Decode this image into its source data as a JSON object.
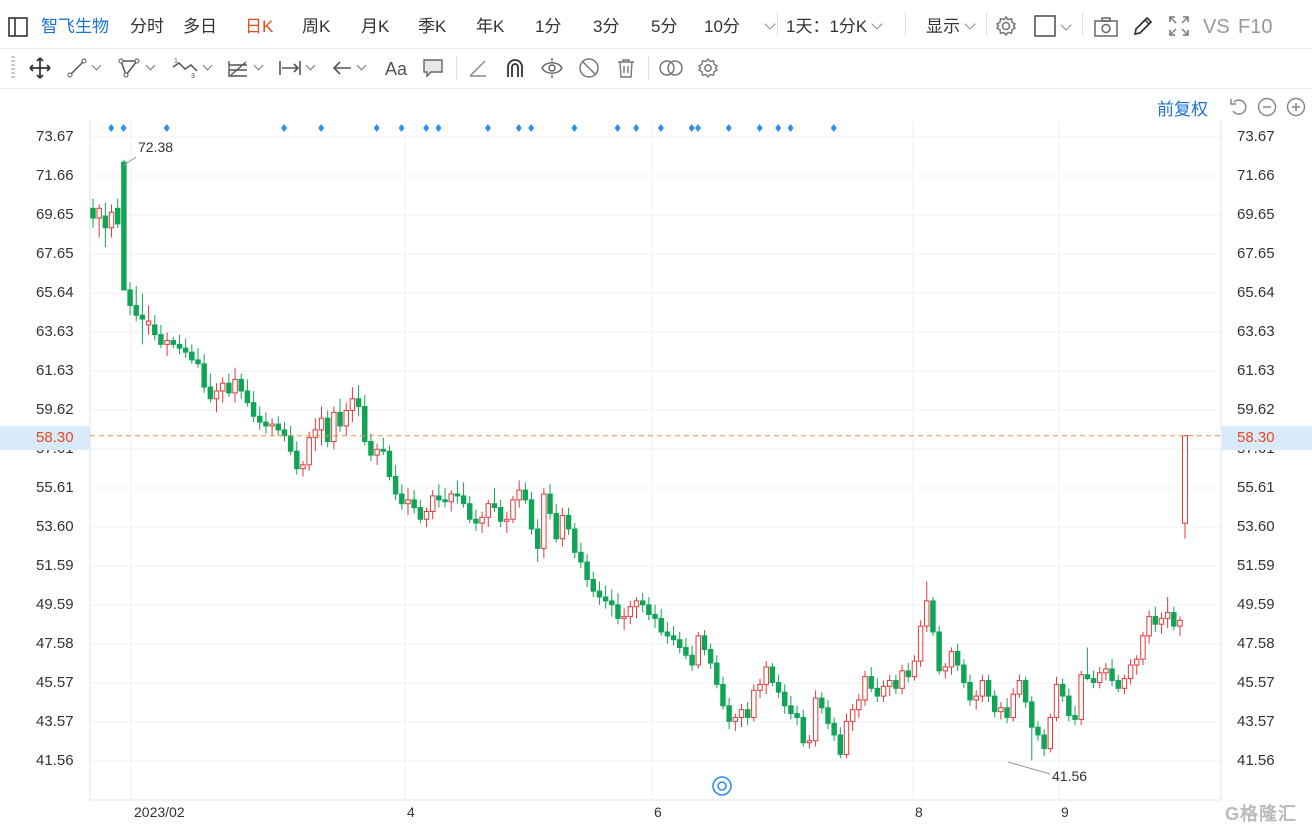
{
  "toolbar": {
    "stock_name": "智飞生物",
    "periods": [
      {
        "label": "分时",
        "active": false
      },
      {
        "label": "多日",
        "active": false
      },
      {
        "label": "日K",
        "active": true
      },
      {
        "label": "周K",
        "active": false
      },
      {
        "label": "月K",
        "active": false
      },
      {
        "label": "季K",
        "active": false
      },
      {
        "label": "年K",
        "active": false
      },
      {
        "label": "1分",
        "active": false
      },
      {
        "label": "3分",
        "active": false
      },
      {
        "label": "5分",
        "active": false
      },
      {
        "label": "10分",
        "active": false
      }
    ],
    "range_select": "1天：1分K",
    "display_label": "显示",
    "vs_label": "VS",
    "f10_label": "F10"
  },
  "drawing_tools": [
    "move-tool",
    "line-tool",
    "polyline-tool",
    "wave-tool",
    "fib-tool",
    "range-tool",
    "arrow-tool",
    "text-tool",
    "comment-tool",
    "ruler-tool",
    "magnet-tool",
    "eye-tool",
    "hide-tool",
    "trash-tool",
    "compare-tool",
    "settings-tool"
  ],
  "adjust_label": "前复权",
  "chart_data": {
    "type": "candlestick",
    "y_ticks": [
      "73.67",
      "71.66",
      "69.65",
      "67.65",
      "65.64",
      "63.63",
      "61.63",
      "59.62",
      "57.61",
      "55.61",
      "53.60",
      "51.59",
      "49.59",
      "47.58",
      "45.57",
      "43.57",
      "41.56"
    ],
    "ylim": [
      41.56,
      73.67
    ],
    "x_ticks": [
      "2023/02",
      "4",
      "6",
      "8",
      "9"
    ],
    "current_price": "58.30",
    "high_label": "72.38",
    "low_label": "41.56",
    "colors": {
      "up": "#e03a3a",
      "down": "#11a456",
      "dash": "#f28b43",
      "marker": "#2f8ef0"
    },
    "candles": [
      [
        70.0,
        70.5,
        69.0,
        69.5
      ],
      [
        69.5,
        70.2,
        68.5,
        70.0
      ],
      [
        69.6,
        70.3,
        68.0,
        69.0
      ],
      [
        69.0,
        70.2,
        68.5,
        69.8
      ],
      [
        70.0,
        70.5,
        69.0,
        69.2
      ],
      [
        72.38,
        72.5,
        66.0,
        65.8
      ],
      [
        65.8,
        66.2,
        64.5,
        65.0
      ],
      [
        65.0,
        66.0,
        64.2,
        64.5
      ],
      [
        64.5,
        65.6,
        63.0,
        64.3
      ],
      [
        64.0,
        65.0,
        63.5,
        64.2
      ],
      [
        64.0,
        64.5,
        63.2,
        63.5
      ],
      [
        63.5,
        64.0,
        62.8,
        63.0
      ],
      [
        63.0,
        63.6,
        62.4,
        63.2
      ],
      [
        63.2,
        63.4,
        62.8,
        63.0
      ],
      [
        63.0,
        63.5,
        62.5,
        62.8
      ],
      [
        62.8,
        63.3,
        62.3,
        62.6
      ],
      [
        62.6,
        63.0,
        62.0,
        62.2
      ],
      [
        62.2,
        62.8,
        61.8,
        62.0
      ],
      [
        62.0,
        62.5,
        60.5,
        60.8
      ],
      [
        60.8,
        61.5,
        60.0,
        60.2
      ],
      [
        60.2,
        61.0,
        59.5,
        60.6
      ],
      [
        60.6,
        61.3,
        60.0,
        61.0
      ],
      [
        61.0,
        61.5,
        60.3,
        60.5
      ],
      [
        60.5,
        61.8,
        60.0,
        61.2
      ],
      [
        61.2,
        61.5,
        60.2,
        60.6
      ],
      [
        60.6,
        61.2,
        59.8,
        60.0
      ],
      [
        60.0,
        60.6,
        59.0,
        59.3
      ],
      [
        59.3,
        59.8,
        58.6,
        59.0
      ],
      [
        59.0,
        59.5,
        58.4,
        58.8
      ],
      [
        58.8,
        59.2,
        58.3,
        58.9
      ],
      [
        58.9,
        59.3,
        58.3,
        58.6
      ],
      [
        58.6,
        59.0,
        58.0,
        58.3
      ],
      [
        58.3,
        58.8,
        57.3,
        57.5
      ],
      [
        57.5,
        58.0,
        56.3,
        56.6
      ],
      [
        56.6,
        57.0,
        56.2,
        56.8
      ],
      [
        56.8,
        58.5,
        56.5,
        58.2
      ],
      [
        58.2,
        59.2,
        57.5,
        58.6
      ],
      [
        58.6,
        59.8,
        57.8,
        59.2
      ],
      [
        59.2,
        59.6,
        57.7,
        58.0
      ],
      [
        58.0,
        59.8,
        57.6,
        59.5
      ],
      [
        59.5,
        60.2,
        58.5,
        58.8
      ],
      [
        58.8,
        60.0,
        58.3,
        59.6
      ],
      [
        59.6,
        60.8,
        59.0,
        60.2
      ],
      [
        60.2,
        60.9,
        59.3,
        59.8
      ],
      [
        59.8,
        60.4,
        57.8,
        58.0
      ],
      [
        58.0,
        58.4,
        57.0,
        57.3
      ],
      [
        57.3,
        57.9,
        56.8,
        57.6
      ],
      [
        57.6,
        58.2,
        57.3,
        57.5
      ],
      [
        57.5,
        57.8,
        56.0,
        56.2
      ],
      [
        56.2,
        56.8,
        55.0,
        55.3
      ],
      [
        55.3,
        55.8,
        54.5,
        54.8
      ],
      [
        54.8,
        55.6,
        54.2,
        55.0
      ],
      [
        55.0,
        55.5,
        54.3,
        54.6
      ],
      [
        54.6,
        55.0,
        53.8,
        54.0
      ],
      [
        54.0,
        54.6,
        53.6,
        54.4
      ],
      [
        54.4,
        55.5,
        54.0,
        55.2
      ],
      [
        55.2,
        55.8,
        54.6,
        55.0
      ],
      [
        55.0,
        55.6,
        54.6,
        54.9
      ],
      [
        54.9,
        55.5,
        54.4,
        55.3
      ],
      [
        55.3,
        56.0,
        54.8,
        55.2
      ],
      [
        55.2,
        55.9,
        54.6,
        54.8
      ],
      [
        54.8,
        55.2,
        53.8,
        54.0
      ],
      [
        54.0,
        54.5,
        53.4,
        53.8
      ],
      [
        53.8,
        54.4,
        53.3,
        54.1
      ],
      [
        54.1,
        55.0,
        53.6,
        54.8
      ],
      [
        54.8,
        55.6,
        54.4,
        54.6
      ],
      [
        54.6,
        55.0,
        53.6,
        53.9
      ],
      [
        53.9,
        54.4,
        53.3,
        54.0
      ],
      [
        54.0,
        55.2,
        53.8,
        55.0
      ],
      [
        55.0,
        56.0,
        54.6,
        55.5
      ],
      [
        55.5,
        55.9,
        54.8,
        55.0
      ],
      [
        55.0,
        55.4,
        53.2,
        53.5
      ],
      [
        53.5,
        54.0,
        51.8,
        52.5
      ],
      [
        52.5,
        55.6,
        52.0,
        55.3
      ],
      [
        55.3,
        55.8,
        54.0,
        54.3
      ],
      [
        54.3,
        54.8,
        52.8,
        53.0
      ],
      [
        53.0,
        54.6,
        52.6,
        54.2
      ],
      [
        54.2,
        54.6,
        53.2,
        53.5
      ],
      [
        53.5,
        53.8,
        52.0,
        52.3
      ],
      [
        52.3,
        52.8,
        51.5,
        51.8
      ],
      [
        51.8,
        52.2,
        50.5,
        50.9
      ],
      [
        50.9,
        51.3,
        50.0,
        50.3
      ],
      [
        50.3,
        50.8,
        49.6,
        50.0
      ],
      [
        50.0,
        50.6,
        49.4,
        49.8
      ],
      [
        49.8,
        50.4,
        49.0,
        49.6
      ],
      [
        49.6,
        50.2,
        48.6,
        48.9
      ],
      [
        48.9,
        49.4,
        48.3,
        49.0
      ],
      [
        49.0,
        49.8,
        48.6,
        49.5
      ],
      [
        49.5,
        50.0,
        48.9,
        49.8
      ],
      [
        49.8,
        50.2,
        49.2,
        49.6
      ],
      [
        49.6,
        50.0,
        48.8,
        49.1
      ],
      [
        49.1,
        49.6,
        48.4,
        48.9
      ],
      [
        48.9,
        49.4,
        48.0,
        48.2
      ],
      [
        48.2,
        48.7,
        47.6,
        48.0
      ],
      [
        48.0,
        48.5,
        47.5,
        47.8
      ],
      [
        47.8,
        48.2,
        47.1,
        47.4
      ],
      [
        47.4,
        47.9,
        46.8,
        47.0
      ],
      [
        47.0,
        47.5,
        46.2,
        46.5
      ],
      [
        46.5,
        48.2,
        46.3,
        48.0
      ],
      [
        48.0,
        48.3,
        47.0,
        47.3
      ],
      [
        47.3,
        47.6,
        46.3,
        46.6
      ],
      [
        46.6,
        47.0,
        45.3,
        45.5
      ],
      [
        45.5,
        45.9,
        44.2,
        44.4
      ],
      [
        44.4,
        44.8,
        43.2,
        43.6
      ],
      [
        43.6,
        44.0,
        43.1,
        43.8
      ],
      [
        43.8,
        44.5,
        43.3,
        44.2
      ],
      [
        44.2,
        44.6,
        43.4,
        43.8
      ],
      [
        43.8,
        45.5,
        43.6,
        45.2
      ],
      [
        45.2,
        45.8,
        44.8,
        45.5
      ],
      [
        45.5,
        46.7,
        45.0,
        46.4
      ],
      [
        46.4,
        46.6,
        45.4,
        45.6
      ],
      [
        45.6,
        46.0,
        44.8,
        45.1
      ],
      [
        45.1,
        45.5,
        44.0,
        44.4
      ],
      [
        44.4,
        44.9,
        43.7,
        44.0
      ],
      [
        44.0,
        44.4,
        43.4,
        43.8
      ],
      [
        43.8,
        44.2,
        42.3,
        42.5
      ],
      [
        42.5,
        42.9,
        42.2,
        42.6
      ],
      [
        42.6,
        45.2,
        42.3,
        44.8
      ],
      [
        44.8,
        45.1,
        44.0,
        44.3
      ],
      [
        44.3,
        44.7,
        43.2,
        43.5
      ],
      [
        43.5,
        43.8,
        42.6,
        42.9
      ],
      [
        42.9,
        43.3,
        41.7,
        41.9
      ],
      [
        41.9,
        44.0,
        41.7,
        43.6
      ],
      [
        43.6,
        44.5,
        43.1,
        44.2
      ],
      [
        44.2,
        45.0,
        43.8,
        44.7
      ],
      [
        44.7,
        46.2,
        44.4,
        45.9
      ],
      [
        45.9,
        46.4,
        45.1,
        45.3
      ],
      [
        45.3,
        45.8,
        44.6,
        44.9
      ],
      [
        44.9,
        45.7,
        44.6,
        45.4
      ],
      [
        45.4,
        46.0,
        44.9,
        45.7
      ],
      [
        45.7,
        46.0,
        45.0,
        45.3
      ],
      [
        45.3,
        46.5,
        45.0,
        46.2
      ],
      [
        46.2,
        46.6,
        45.6,
        45.9
      ],
      [
        45.9,
        47.0,
        45.7,
        46.7
      ],
      [
        46.7,
        48.8,
        46.4,
        48.5
      ],
      [
        48.5,
        50.8,
        48.2,
        49.8
      ],
      [
        49.8,
        50.0,
        48.0,
        48.2
      ],
      [
        48.2,
        48.5,
        46.0,
        46.2
      ],
      [
        46.2,
        46.6,
        45.8,
        46.4
      ],
      [
        46.4,
        47.4,
        46.0,
        47.2
      ],
      [
        47.2,
        47.6,
        46.2,
        46.5
      ],
      [
        46.5,
        46.8,
        45.3,
        45.6
      ],
      [
        45.6,
        46.0,
        44.4,
        44.7
      ],
      [
        44.7,
        45.2,
        44.2,
        44.9
      ],
      [
        44.9,
        46.0,
        44.6,
        45.7
      ],
      [
        45.7,
        46.0,
        44.6,
        44.9
      ],
      [
        44.9,
        45.2,
        43.8,
        44.1
      ],
      [
        44.1,
        44.6,
        43.7,
        44.3
      ],
      [
        44.3,
        44.8,
        43.5,
        43.8
      ],
      [
        43.8,
        45.3,
        43.6,
        45.0
      ],
      [
        45.0,
        46.0,
        44.8,
        45.7
      ],
      [
        45.7,
        45.9,
        44.3,
        44.6
      ],
      [
        44.6,
        44.9,
        41.6,
        43.3
      ],
      [
        43.3,
        43.6,
        42.6,
        42.9
      ],
      [
        42.9,
        43.2,
        41.8,
        42.2
      ],
      [
        42.2,
        44.0,
        42.0,
        43.8
      ],
      [
        43.8,
        45.9,
        43.6,
        45.5
      ],
      [
        45.5,
        45.8,
        44.6,
        44.9
      ],
      [
        44.9,
        45.3,
        43.6,
        43.9
      ],
      [
        43.9,
        44.4,
        43.4,
        43.7
      ],
      [
        43.7,
        46.2,
        43.4,
        46.0
      ],
      [
        46.0,
        47.4,
        45.7,
        45.8
      ],
      [
        45.8,
        46.2,
        45.3,
        45.6
      ],
      [
        45.6,
        46.4,
        45.3,
        46.1
      ],
      [
        46.1,
        46.6,
        45.7,
        46.3
      ],
      [
        46.3,
        46.8,
        45.4,
        45.7
      ],
      [
        45.7,
        46.0,
        45.1,
        45.3
      ],
      [
        45.3,
        46.0,
        45.0,
        45.8
      ],
      [
        45.8,
        46.8,
        45.5,
        46.5
      ],
      [
        46.5,
        47.0,
        46.0,
        46.8
      ],
      [
        46.8,
        48.2,
        46.5,
        48.0
      ],
      [
        48.0,
        49.3,
        47.6,
        49.0
      ],
      [
        49.0,
        49.5,
        48.2,
        48.6
      ],
      [
        48.6,
        49.2,
        48.1,
        48.9
      ],
      [
        48.9,
        50.0,
        48.4,
        49.2
      ],
      [
        49.2,
        49.5,
        48.3,
        48.5
      ],
      [
        48.5,
        49.0,
        48.0,
        48.8
      ]
    ],
    "last_candle": [
      53.8,
      58.3,
      53.0,
      58.3
    ]
  }
}
